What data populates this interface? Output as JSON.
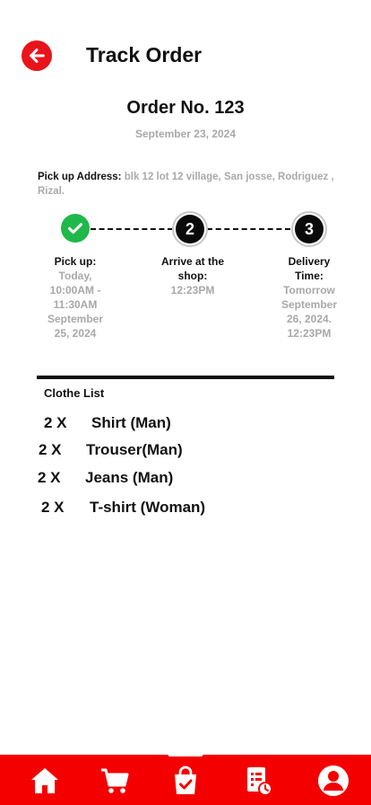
{
  "header": {
    "title": "Track Order"
  },
  "order": {
    "number_label": "Order No. 123",
    "date": "September 23, 2024"
  },
  "pickup_address": {
    "label": "Pick up Address:",
    "value": "blk 12 lot 12 village, San josse, Rodriguez , Rizal."
  },
  "steps": [
    {
      "number": "",
      "status": "completed",
      "title": "Pick up:",
      "detail": "Today, 10:00AM - 11:30AM September 25, 2024"
    },
    {
      "number": "2",
      "status": "pending",
      "title": "Arrive at the shop:",
      "detail": "12:23PM"
    },
    {
      "number": "3",
      "status": "pending",
      "title": "Delivery Time:",
      "detail": "Tomorrow September 26, 2024. 12:23PM"
    }
  ],
  "clothe_list": {
    "title": "Clothe List",
    "items": [
      {
        "qty": "2 X",
        "name": "Shirt (Man)"
      },
      {
        "qty": "2 X",
        "name": "Trouser(Man)"
      },
      {
        "qty": "2 X",
        "name": "Jeans (Man)"
      },
      {
        "qty": "2 X",
        "name": "T-shirt (Woman)"
      }
    ]
  },
  "bottom_nav": {
    "items": [
      {
        "icon": "home-icon"
      },
      {
        "icon": "cart-icon"
      },
      {
        "icon": "shopping-bag-check-icon",
        "active": true
      },
      {
        "icon": "order-list-clock-icon"
      },
      {
        "icon": "user-profile-icon"
      }
    ]
  },
  "colors": {
    "accent": "#f50000",
    "success": "#1fb84a",
    "muted": "#a8a8a8"
  }
}
